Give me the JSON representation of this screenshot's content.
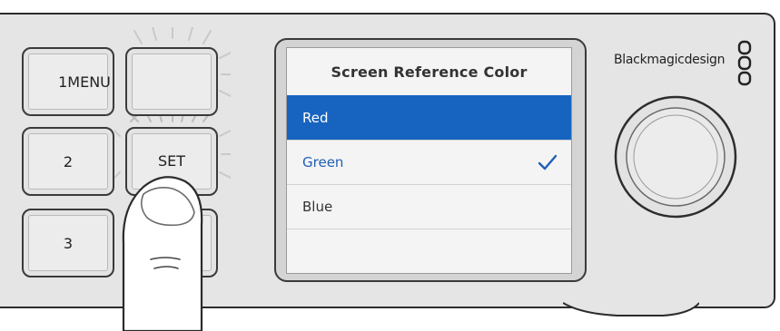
{
  "keys": {
    "menu_label": "1MENU",
    "two_label": "2",
    "set_label": "SET",
    "three_label": "3"
  },
  "screen": {
    "title": "Screen Reference Color",
    "options": [
      {
        "label": "Red",
        "selected": true,
        "checked": false
      },
      {
        "label": "Green",
        "selected": false,
        "checked": true
      },
      {
        "label": "Blue",
        "selected": false,
        "checked": false
      }
    ]
  },
  "brand": {
    "name": "Blackmagicdesign"
  },
  "colors": {
    "selection": "#1764c0",
    "checked_text": "#1f5fb5",
    "panel": "#e5e5e5"
  }
}
